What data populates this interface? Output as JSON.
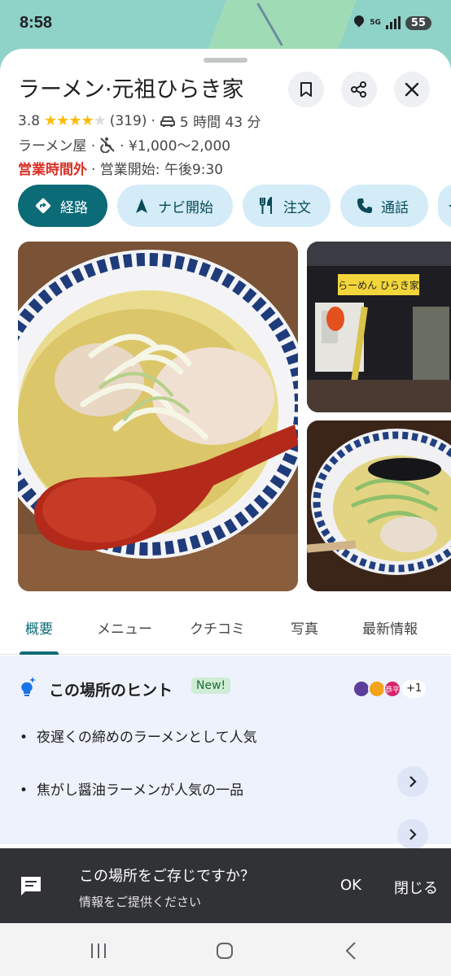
{
  "status_bar": {
    "time": "8:58",
    "network": "5G",
    "battery": "55"
  },
  "place": {
    "name": "ラーメン·元祖ひらき家",
    "rating": "3.8",
    "rating_value": 3.8,
    "review_count": "(319)",
    "separator": "·",
    "drive_time": "5 時間 43 分",
    "category": "ラーメン屋 ·",
    "price_range": "· ¥1,000〜2,000",
    "status": "営業時間外",
    "opens": "· 営業開始: 午後9:30"
  },
  "actions": [
    {
      "label": "経路",
      "icon": "directions-icon"
    },
    {
      "label": "ナビ開始",
      "icon": "navigation-icon"
    },
    {
      "label": "注文",
      "icon": "restaurant-icon"
    },
    {
      "label": "通話",
      "icon": "phone-icon"
    }
  ],
  "photos": {
    "sign_text": "らーめん ひらき家"
  },
  "tabs": [
    {
      "label": "概要",
      "active": true
    },
    {
      "label": "メニュー",
      "active": false
    },
    {
      "label": "クチコミ",
      "active": false
    },
    {
      "label": "写真",
      "active": false
    },
    {
      "label": "最新情報",
      "active": false
    }
  ],
  "hints": {
    "title": "この場所のヒント",
    "badge": "New!",
    "avatar_label": "恭平",
    "more_count": "+1",
    "items": [
      "夜遅くの締めのラーメンとして人気",
      "焦がし醤油ラーメンが人気の一品"
    ]
  },
  "snackbar": {
    "title": "この場所をご存じですか？",
    "subtitle": "情報をご提供ください",
    "ok": "OK",
    "close": "閉じる"
  },
  "colors": {
    "accent": "#0b6b77",
    "pill_bg": "#d3ecf8",
    "closed": "#d93025",
    "star": "#fbbc04"
  }
}
